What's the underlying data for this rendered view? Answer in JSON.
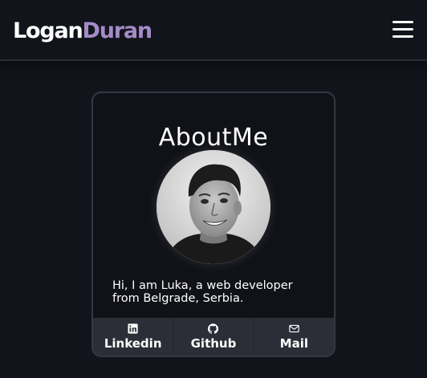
{
  "navbar": {
    "logo_first": "Logan",
    "logo_last": "Duran",
    "menu_icon": "hamburger-menu-icon"
  },
  "about": {
    "title": "AboutMe",
    "avatar_alt": "profile-photo",
    "bio": "Hi, I am Luka, a web developer from Belgrade, Serbia."
  },
  "links": [
    {
      "label": "Linkedin",
      "icon": "linkedin-icon"
    },
    {
      "label": "Github",
      "icon": "github-icon"
    },
    {
      "label": "Mail",
      "icon": "mail-icon"
    }
  ],
  "colors": {
    "background": "#12141b",
    "accent": "#a48bc7",
    "card_border": "#353842",
    "links_bar": "#2b2e37"
  }
}
